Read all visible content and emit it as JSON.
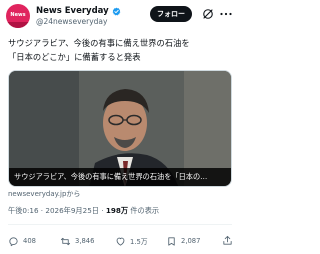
{
  "account": {
    "avatar_text": "News",
    "name": "News Everyday",
    "handle": "@24newseveryday",
    "follow_label": "フォロー"
  },
  "tweet": {
    "text": "サウジアラビア、今後の有事に備え世界の石油を\n「日本のどこか」に備蓄すると発表",
    "media_caption": "サウジアラビア、今後の有事に備え世界の石油を「日本の…",
    "source_domain": "newseveryday.jpから",
    "time": "午後0:16",
    "date": "2026年9月25日",
    "views_count": "198万",
    "views_label": "件の表示"
  },
  "actions": {
    "replies": "408",
    "reposts": "3,846",
    "likes": "1.5万",
    "bookmarks": "2,087"
  },
  "icons": [
    "verified-badge-icon",
    "grok-icon",
    "more-icon",
    "reply-icon",
    "repost-icon",
    "like-icon",
    "bookmark-icon",
    "share-icon"
  ],
  "colors": {
    "accent": "#1d9bf0",
    "avatar": "#e0245e",
    "text": "#0f1419",
    "muted": "#536471"
  }
}
